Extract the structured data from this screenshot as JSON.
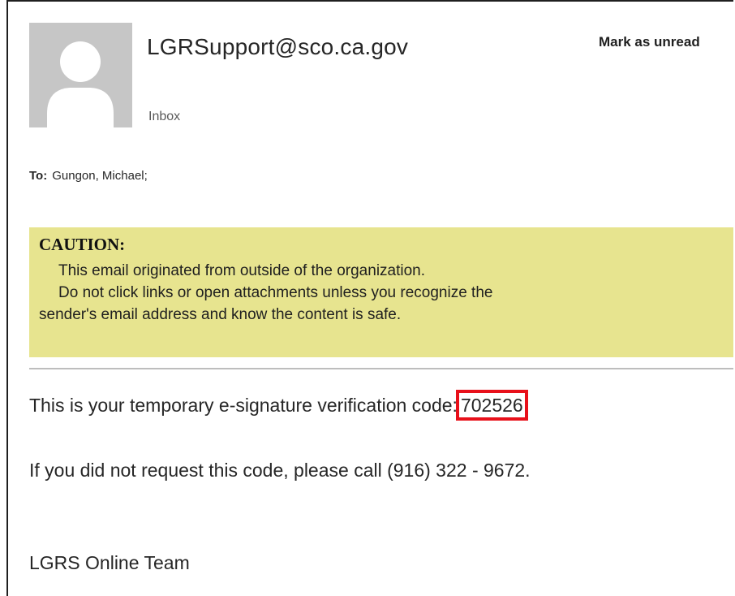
{
  "email": {
    "sender": "LGRSupport@sco.ca.gov",
    "folder": "Inbox",
    "mark_unread_label": "Mark as unread",
    "to_label": "To:",
    "to_value": "Gungon, Michael;"
  },
  "caution": {
    "title": "CAUTION:",
    "line1": "This email originated from outside of the organization.",
    "line2a": "Do not click links or open attachments unless you recognize the",
    "line2b": "sender's email address and know the content is safe.",
    "background_color": "#e7e48f"
  },
  "body": {
    "code_prefix": "This is your temporary e-signature verification code:",
    "code": "702526",
    "call_line": "If you did not request this code, please call (916) 322 - 9672.",
    "signature": "LGRS Online Team"
  },
  "highlight_color": "#e8101a",
  "icons": {
    "avatar": "default-person-avatar-icon"
  }
}
